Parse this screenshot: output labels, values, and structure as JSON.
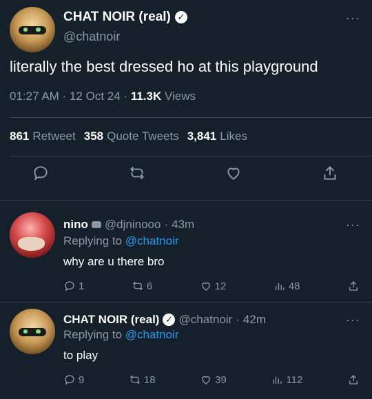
{
  "main_tweet": {
    "display_name": "CHAT NOIR (real)",
    "handle": "@chatnoir",
    "more_icon": "···",
    "text": "literally the best dressed ho at this playground",
    "time": "01:27 AM",
    "date": "12 Oct 24",
    "views_count": "11.3K",
    "views_label": "Views",
    "retweets_count": "861",
    "retweets_label": "Retweet",
    "quotes_count": "358",
    "quotes_label": "Quote Tweets",
    "likes_count": "3,841",
    "likes_label": "Likes"
  },
  "replies": [
    {
      "display_name": "nino",
      "handle": "@djninooo",
      "age": "43m",
      "replying_label": "Replying to",
      "replying_to": "@chatnoir",
      "text": "why are u there bro",
      "replies": "1",
      "retweets": "6",
      "likes": "12",
      "views": "48"
    },
    {
      "display_name": "CHAT NOIR (real)",
      "handle": "@chatnoir",
      "age": "42m",
      "replying_label": "Replying to",
      "replying_to": "@chatnoir",
      "text": "to play",
      "replies": "9",
      "retweets": "18",
      "likes": "39",
      "views": "112"
    }
  ],
  "separator": "·",
  "verified_glyph": "✓"
}
